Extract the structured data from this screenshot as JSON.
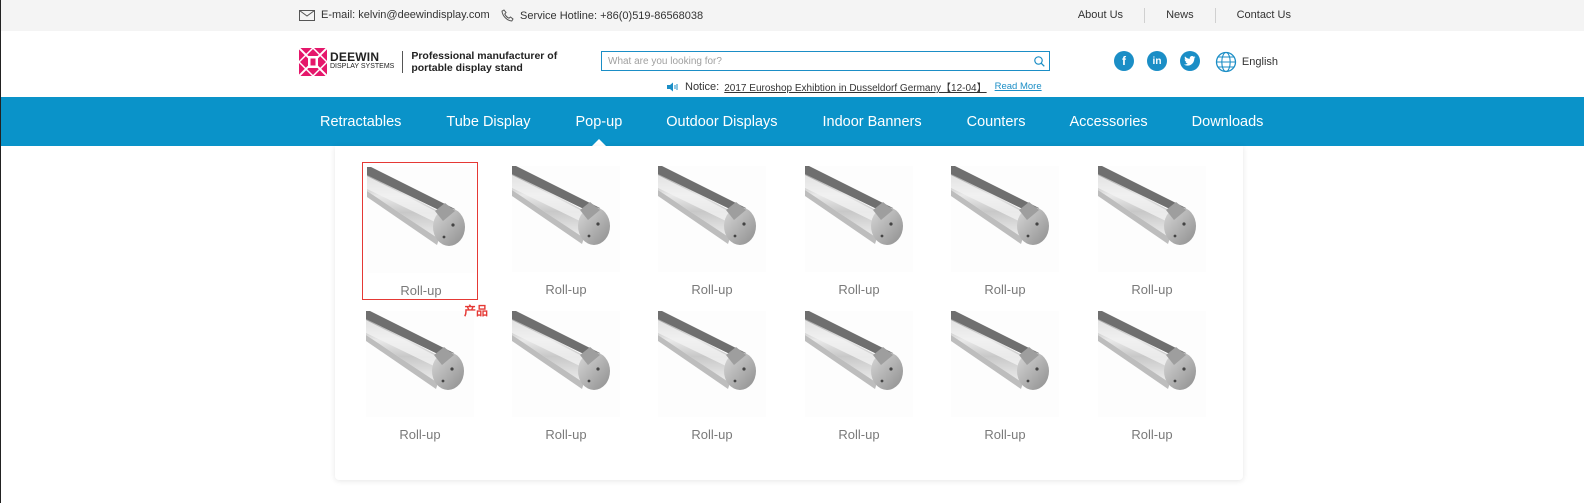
{
  "topbar": {
    "email": "E-mail: kelvin@deewindisplay.com",
    "hotline": "Service Hotline: +86(0)519-86568038",
    "links": [
      "About Us",
      "News",
      "Contact Us"
    ]
  },
  "header": {
    "logo_line1": "DEEWIN",
    "logo_line2": "DISPLAY SYSTEMS",
    "tagline": "Professional manufacturer of portable display stand",
    "search_placeholder": "What are you looking for?",
    "notice_label": "Notice:",
    "notice_text": "2017 Euroshop Exhibtion in Dusseldorf Germany【12-04】",
    "notice_more": "Read More",
    "social": [
      "facebook-icon",
      "linkedin-icon",
      "twitter-icon"
    ],
    "language": "English"
  },
  "nav": {
    "items": [
      "Retractables",
      "Tube Display",
      "Pop-up",
      "Outdoor Displays",
      "Indoor Banners",
      "Counters",
      "Accessories",
      "Downloads"
    ],
    "active": "Pop-up"
  },
  "dropdown": {
    "products": [
      "Roll-up",
      "Roll-up",
      "Roll-up",
      "Roll-up",
      "Roll-up",
      "Roll-up",
      "Roll-up",
      "Roll-up",
      "Roll-up",
      "Roll-up",
      "Roll-up",
      "Roll-up"
    ],
    "selected_badge": "产品"
  },
  "colors": {
    "brand_blue": "#0a93c9",
    "logo_pink": "#e5176b",
    "highlight_red": "#e53935"
  }
}
